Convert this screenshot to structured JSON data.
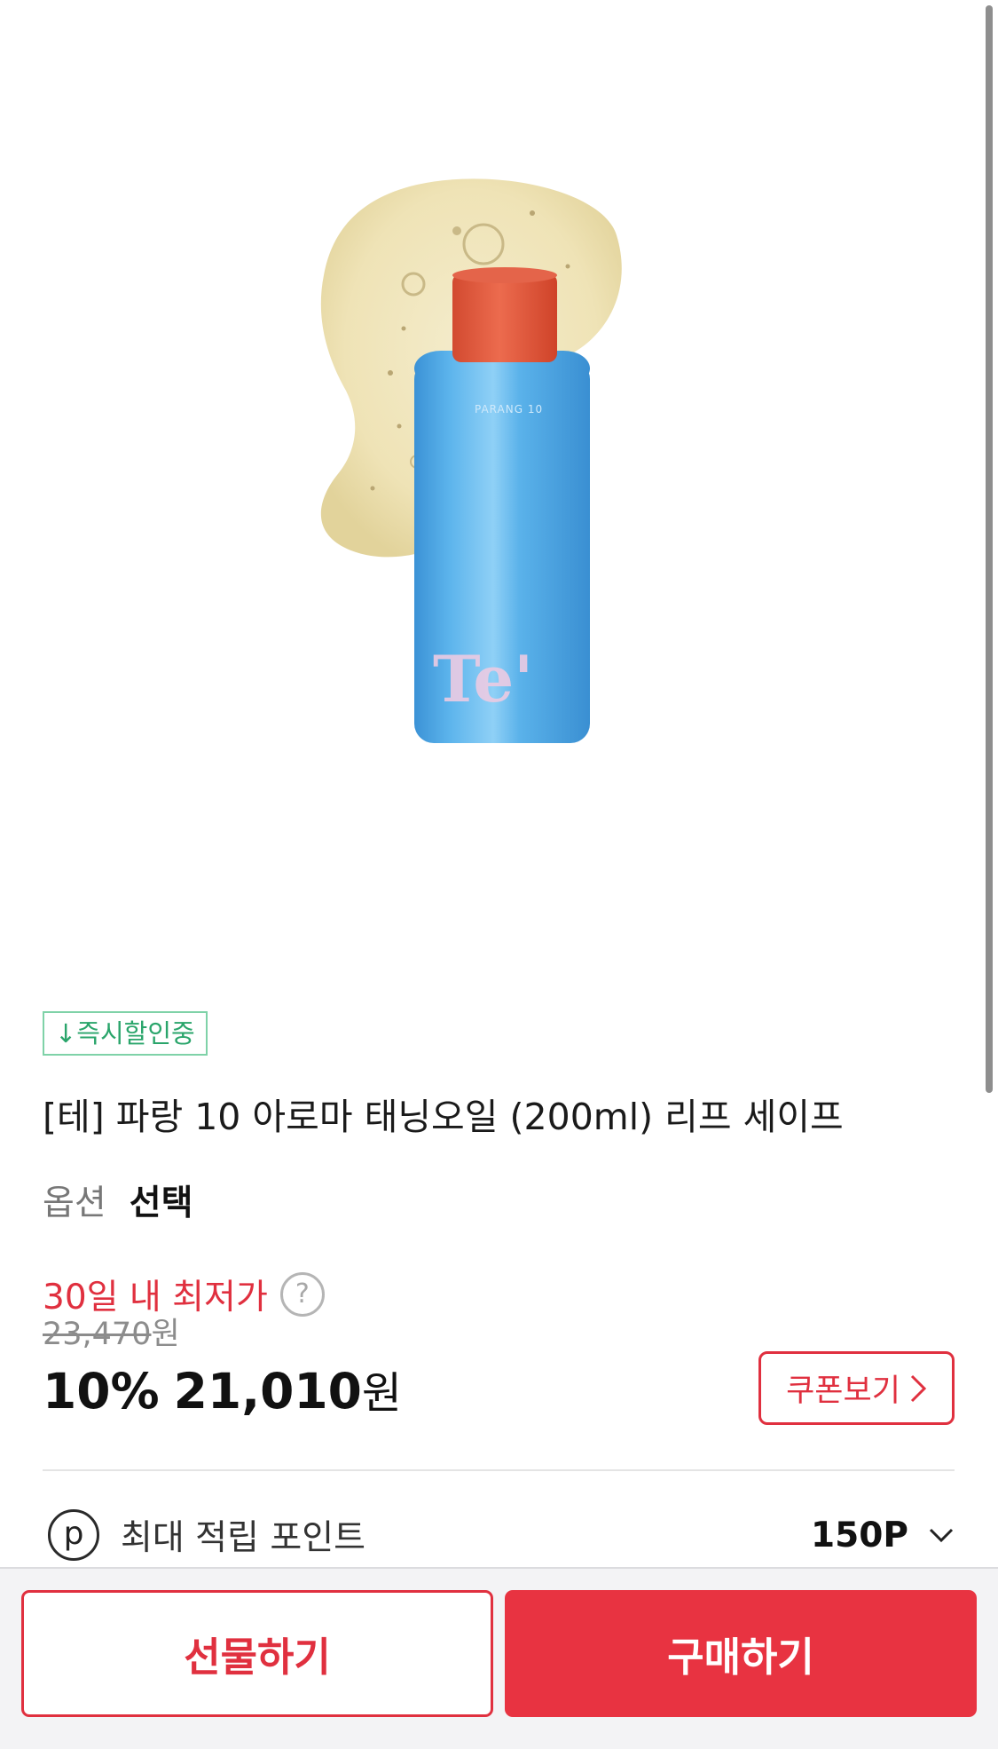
{
  "product": {
    "image_alt": "product-image",
    "bottle_brand_small": "PARANG 10",
    "bottle_logo": "Te'",
    "badge": "↓즉시할인중",
    "title": "[테] 파랑 10 아로마 태닝오일 (200ml) 리프 세이프",
    "option_label": "옵션",
    "option_value": "선택"
  },
  "price": {
    "lowest_label": "30일 내 최저가",
    "help_icon": "question-icon",
    "original_price": "23,470",
    "original_unit": "원",
    "discount_rate": "10%",
    "sale_price": "21,010",
    "sale_unit": "원",
    "coupon_label": "쿠폰보기"
  },
  "points": {
    "icon": "points-icon",
    "icon_letter": "p",
    "label": "최대 적립 포인트",
    "value": "150P"
  },
  "actions": {
    "gift_label": "선물하기",
    "buy_label": "구매하기"
  },
  "colors": {
    "accent_red": "#e0303f",
    "buy_button": "#e83341",
    "badge_green": "#2aa56b",
    "bottle_blue": "#4fa8e2",
    "cap_red": "#e0573b"
  }
}
